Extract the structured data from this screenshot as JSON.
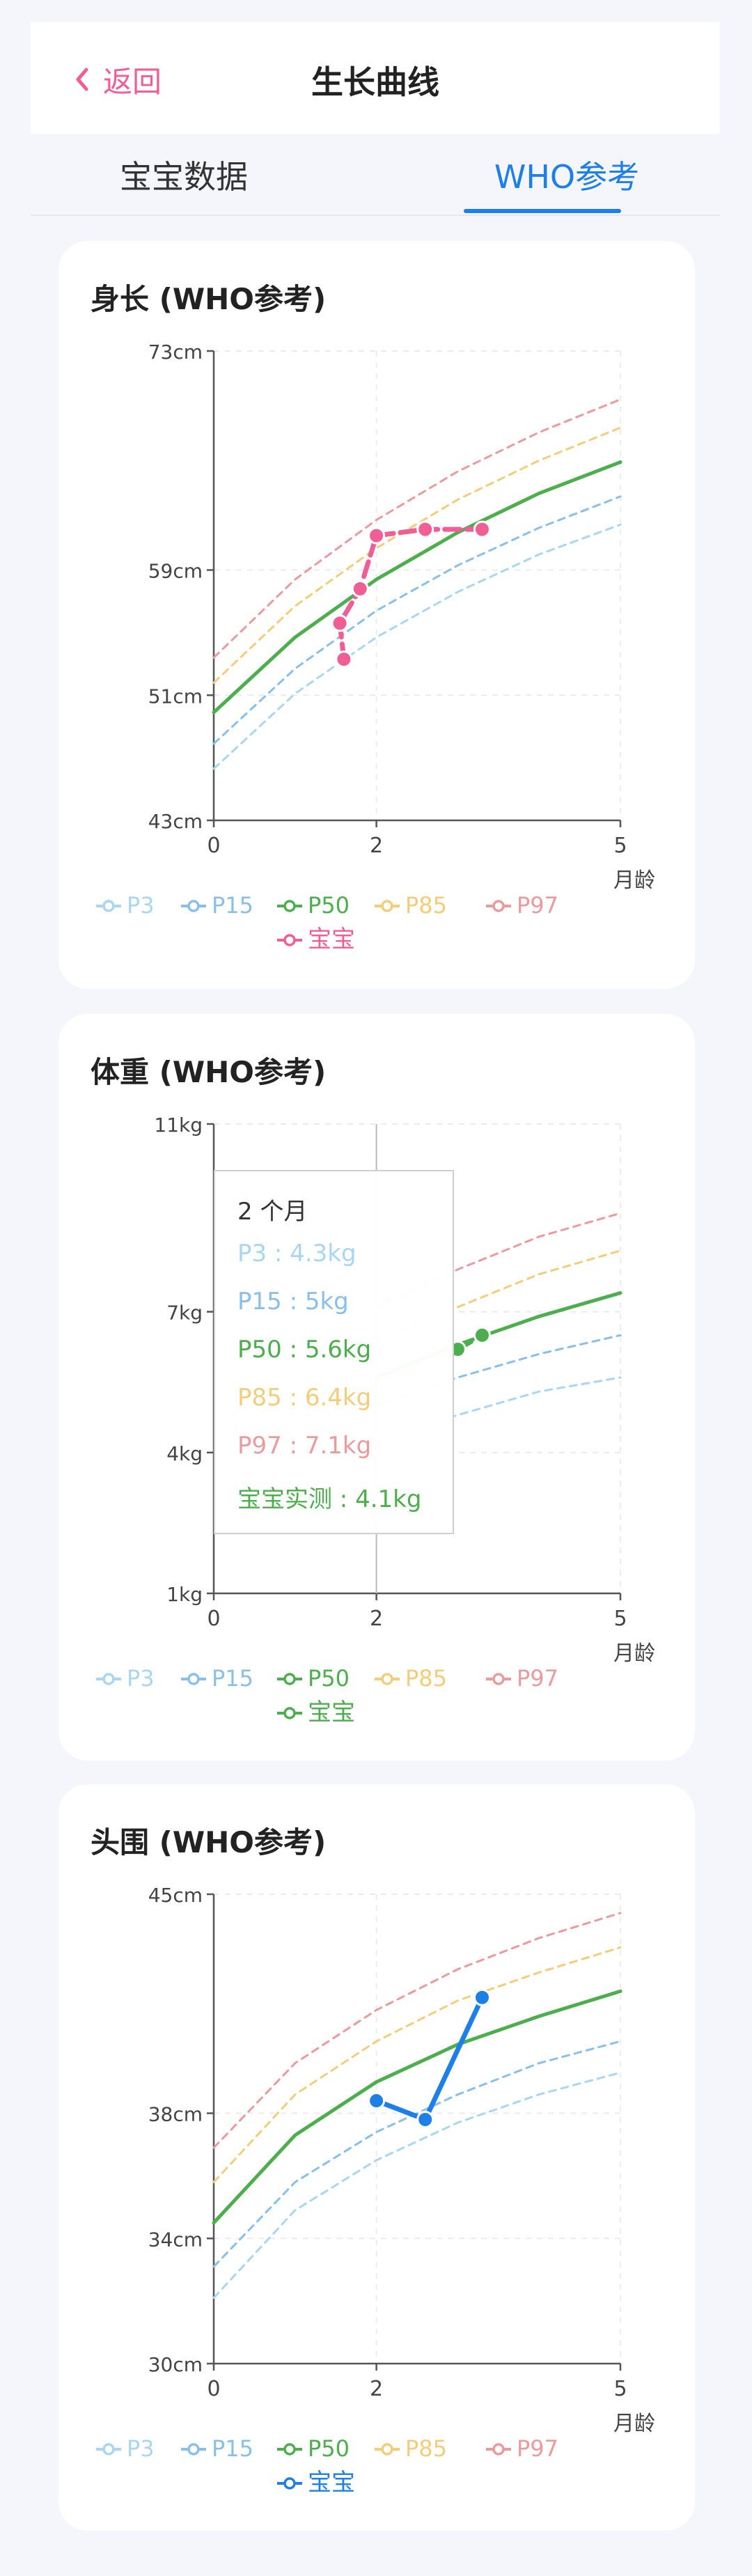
{
  "header": {
    "back_label": "返回",
    "title": "生长曲线"
  },
  "tabs": [
    {
      "label": "宝宝数据",
      "active": false
    },
    {
      "label": "WHO参考",
      "active": true
    }
  ],
  "colors": {
    "accent_pink": "#ef5f95",
    "accent_blue": "#1e7fe6",
    "P3": "#a9d6f1",
    "P15": "#89c0ea",
    "P50": "#4cae4c",
    "P85": "#f4cd7a",
    "P97": "#eb9b9d",
    "baby_height": "#ef5f95",
    "baby_weight": "#4cae4c",
    "baby_head": "#1e7fe6"
  },
  "legend": {
    "series": [
      "P3",
      "P15",
      "P50",
      "P85",
      "P97"
    ],
    "baby": "宝宝"
  },
  "x_unit": "月龄",
  "chart_data": [
    {
      "type": "line",
      "title": "身长 (WHO参考)",
      "xlabel": "月龄",
      "x_ticks": [
        "0",
        "2",
        "5"
      ],
      "xlim": [
        0,
        5
      ],
      "y_ticks": [
        "73cm",
        "59cm",
        "51cm",
        "43cm"
      ],
      "y_tick_values": [
        73,
        59,
        51,
        43
      ],
      "ylim": [
        43,
        73
      ],
      "grid": true,
      "legend_placement": "bottom",
      "series": [
        {
          "name": "P3",
          "x": [
            0,
            1,
            2,
            3,
            4,
            5
          ],
          "values": [
            46.3,
            51.1,
            54.7,
            57.6,
            60.0,
            61.9
          ]
        },
        {
          "name": "P15",
          "x": [
            0,
            1,
            2,
            3,
            4,
            5
          ],
          "values": [
            47.9,
            52.7,
            56.4,
            59.3,
            61.7,
            63.7
          ]
        },
        {
          "name": "P50",
          "x": [
            0,
            1,
            2,
            3,
            4,
            5
          ],
          "values": [
            49.9,
            54.7,
            58.4,
            61.4,
            63.9,
            65.9
          ]
        },
        {
          "name": "P85",
          "x": [
            0,
            1,
            2,
            3,
            4,
            5
          ],
          "values": [
            51.8,
            56.7,
            60.4,
            63.5,
            66.0,
            68.1
          ]
        },
        {
          "name": "P97",
          "x": [
            0,
            1,
            2,
            3,
            4,
            5
          ],
          "values": [
            53.4,
            58.4,
            62.2,
            65.3,
            67.8,
            69.9
          ]
        },
        {
          "name": "宝宝",
          "x": [
            1.6,
            1.55,
            1.8,
            2.0,
            2.6,
            3.3
          ],
          "values": [
            53.3,
            55.6,
            57.8,
            61.2,
            61.6,
            61.6
          ]
        }
      ]
    },
    {
      "type": "line",
      "title": "体重 (WHO参考)",
      "xlabel": "月龄",
      "x_ticks": [
        "0",
        "2",
        "5"
      ],
      "xlim": [
        0,
        5
      ],
      "y_ticks": [
        "11kg",
        "7kg",
        "4kg",
        "1kg"
      ],
      "y_tick_values": [
        11,
        7,
        4,
        1
      ],
      "ylim": [
        1,
        11
      ],
      "grid": true,
      "legend_placement": "bottom",
      "series": [
        {
          "name": "P3",
          "x": [
            2,
            3,
            4,
            5
          ],
          "values": [
            4.3,
            4.8,
            5.3,
            5.6
          ]
        },
        {
          "name": "P15",
          "x": [
            2,
            3,
            4,
            5
          ],
          "values": [
            5,
            5.6,
            6.1,
            6.5
          ]
        },
        {
          "name": "P50",
          "x": [
            2,
            3,
            4,
            5
          ],
          "values": [
            5.6,
            6.3,
            6.9,
            7.4
          ]
        },
        {
          "name": "P85",
          "x": [
            2,
            3,
            4,
            5
          ],
          "values": [
            6.4,
            7.1,
            7.8,
            8.3
          ]
        },
        {
          "name": "P97",
          "x": [
            2,
            3,
            4,
            5
          ],
          "values": [
            7.1,
            7.9,
            8.6,
            9.1
          ]
        },
        {
          "name": "宝宝",
          "x": [
            3.0,
            3.3
          ],
          "values": [
            6.2,
            6.5
          ]
        }
      ],
      "tooltip": {
        "title": "2 个月",
        "rows": [
          {
            "text": "P3 : 4.3kg",
            "series": "P3"
          },
          {
            "text": "P15 : 5kg",
            "series": "P15"
          },
          {
            "text": "P50 : 5.6kg",
            "series": "P50"
          },
          {
            "text": "P85 : 6.4kg",
            "series": "P85"
          },
          {
            "text": "P97 : 7.1kg",
            "series": "P97"
          },
          {
            "text": "宝宝实测 : 4.1kg",
            "series": "baby_weight"
          }
        ]
      }
    },
    {
      "type": "line",
      "title": "头围 (WHO参考)",
      "xlabel": "月龄",
      "x_ticks": [
        "0",
        "2",
        "5"
      ],
      "xlim": [
        0,
        5
      ],
      "y_ticks": [
        "45cm",
        "38cm",
        "34cm",
        "30cm"
      ],
      "y_tick_values": [
        45,
        38,
        34,
        30
      ],
      "ylim": [
        30,
        45
      ],
      "grid": true,
      "legend_placement": "bottom",
      "series": [
        {
          "name": "P3",
          "x": [
            0,
            1,
            2,
            3,
            4,
            5
          ],
          "values": [
            32.1,
            34.9,
            36.5,
            37.7,
            38.6,
            39.3
          ]
        },
        {
          "name": "P15",
          "x": [
            0,
            1,
            2,
            3,
            4,
            5
          ],
          "values": [
            33.1,
            35.8,
            37.4,
            38.6,
            39.6,
            40.3
          ]
        },
        {
          "name": "P50",
          "x": [
            0,
            1,
            2,
            3,
            4,
            5
          ],
          "values": [
            34.5,
            37.3,
            39.0,
            40.2,
            41.1,
            41.9
          ]
        },
        {
          "name": "P85",
          "x": [
            0,
            1,
            2,
            3,
            4,
            5
          ],
          "values": [
            35.8,
            38.6,
            40.3,
            41.6,
            42.5,
            43.3
          ]
        },
        {
          "name": "P97",
          "x": [
            0,
            1,
            2,
            3,
            4,
            5
          ],
          "values": [
            36.9,
            39.6,
            41.3,
            42.6,
            43.6,
            44.4
          ]
        },
        {
          "name": "宝宝",
          "x": [
            2.0,
            2.6,
            3.3
          ],
          "values": [
            38.4,
            37.8,
            41.7
          ]
        }
      ]
    }
  ]
}
